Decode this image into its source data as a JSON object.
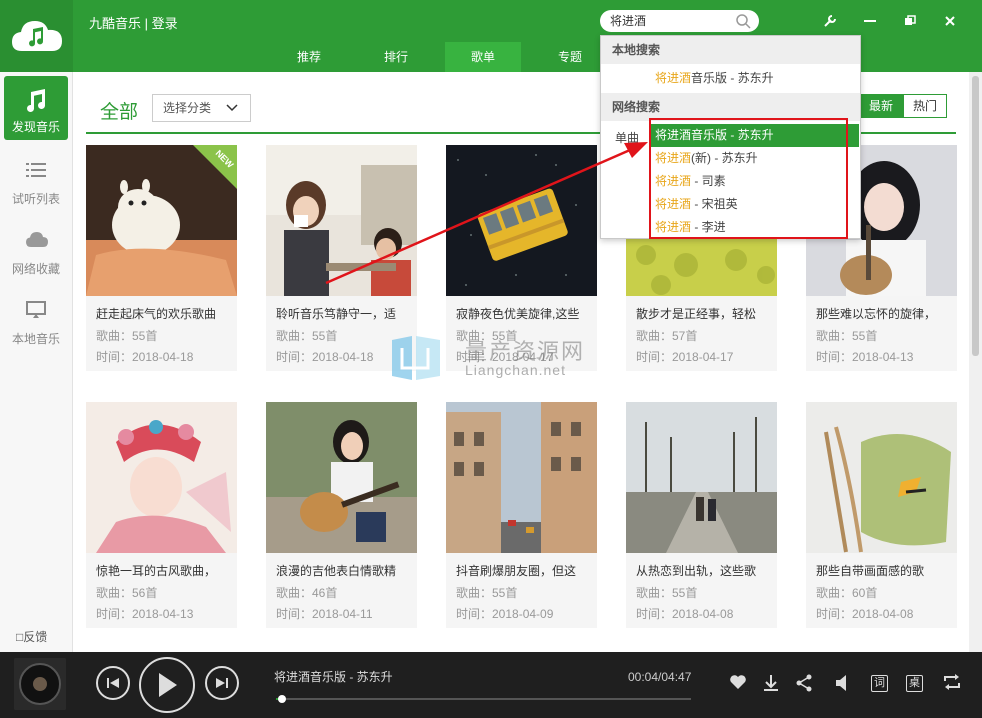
{
  "app": {
    "title": "九酷音乐 | 登录"
  },
  "search": {
    "query": "将进酒"
  },
  "tabs": [
    {
      "label": "推荐",
      "active": false
    },
    {
      "label": "排行",
      "active": false
    },
    {
      "label": "歌单",
      "active": true
    },
    {
      "label": "专题",
      "active": false
    }
  ],
  "sidebar": {
    "items": [
      {
        "label": "发现音乐",
        "icon": "music-note-icon",
        "active": true
      },
      {
        "label": "试听列表",
        "icon": "list-icon",
        "active": false
      },
      {
        "label": "网络收藏",
        "icon": "cloud-icon",
        "active": false
      },
      {
        "label": "本地音乐",
        "icon": "monitor-icon",
        "active": false
      }
    ],
    "feedback": "反馈"
  },
  "filter": {
    "all_label": "全部",
    "category_select": "选择分类",
    "sort_latest": "最新",
    "sort_hot": "热门"
  },
  "cards": [
    {
      "title": "赶走起床气的欢乐歌曲",
      "count": "歌曲：55首",
      "date": "时间：2018-04-18",
      "badge": "NEW"
    },
    {
      "title": "聆听音乐笃静守一，适",
      "count": "歌曲：55首",
      "date": "时间：2018-04-18"
    },
    {
      "title": "寂静夜色优美旋律,这些",
      "count": "歌曲：55首",
      "date": "时间：2018-04-17"
    },
    {
      "title": "散步才是正经事，轻松",
      "count": "歌曲：57首",
      "date": "时间：2018-04-17"
    },
    {
      "title": "那些难以忘怀的旋律，",
      "count": "歌曲：55首",
      "date": "时间：2018-04-13"
    },
    {
      "title": "惊艳一耳的古风歌曲，",
      "count": "歌曲：56首",
      "date": "时间：2018-04-13"
    },
    {
      "title": "浪漫的吉他表白情歌精",
      "count": "歌曲：46首",
      "date": "时间：2018-04-11"
    },
    {
      "title": "抖音刷爆朋友圈，但这",
      "count": "歌曲：55首",
      "date": "时间：2018-04-09"
    },
    {
      "title": "从热恋到出轨，这些歌",
      "count": "歌曲：55首",
      "date": "时间：2018-04-08"
    },
    {
      "title": "那些自带画面感的歌",
      "count": "歌曲：60首",
      "date": "时间：2018-04-08"
    }
  ],
  "dropdown": {
    "local_header": "本地搜索",
    "local_result": {
      "hl": "将进酒",
      "rest": "音乐版 - 苏东升"
    },
    "net_header": "网络搜索",
    "net_label": "单曲",
    "net_results": [
      {
        "hl": "将进酒",
        "rest": "音乐版 - 苏东升",
        "selected": true
      },
      {
        "hl": "将进酒",
        "rest": "(新) - 苏东升",
        "selected": false
      },
      {
        "hl": "将进酒",
        "rest": " - 司素",
        "selected": false
      },
      {
        "hl": "将进酒",
        "rest": " - 宋祖英",
        "selected": false
      },
      {
        "hl": "将进酒",
        "rest": " - 李进",
        "selected": false
      }
    ]
  },
  "watermark": {
    "text": "量产资源网",
    "url": "Liangchan.net"
  },
  "player": {
    "song": "将进酒音乐版 - 苏东升",
    "time": "00:04/04:47",
    "progress": 0.014,
    "lyric_btn": "词",
    "desktop_btn": "桌"
  },
  "colors": {
    "brand": "#2e9c36",
    "highlight": "#e8a61a",
    "annotation": "#e0141a"
  }
}
